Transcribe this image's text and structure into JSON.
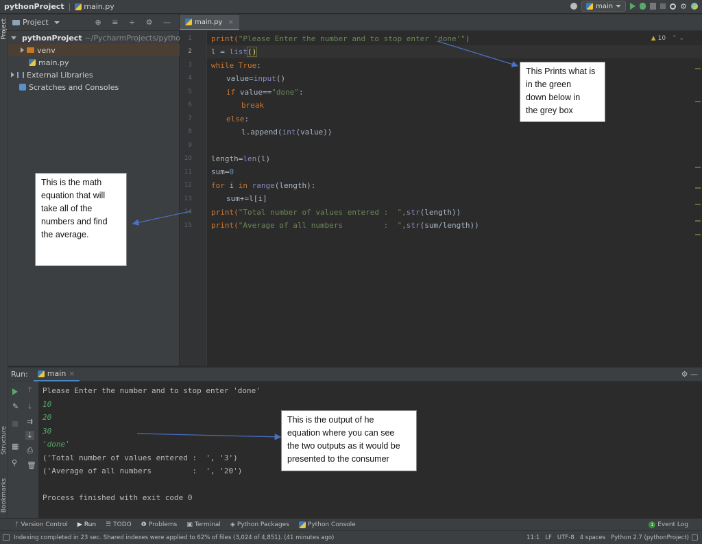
{
  "titlebar": {
    "project": "pythonProject",
    "file": "main.py",
    "run_config": "main"
  },
  "project_panel": {
    "header": "Project",
    "items": [
      {
        "label": "pythonProject",
        "path": "~/PycharmProjects/pythonProject"
      },
      {
        "label": "venv"
      },
      {
        "label": "main.py"
      },
      {
        "label": "External Libraries"
      },
      {
        "label": "Scratches and Consoles"
      }
    ]
  },
  "left_strip": {
    "project": "Project",
    "structure": "Structure",
    "bookmarks": "Bookmarks"
  },
  "editor": {
    "tab": "main.py",
    "warnings": "10",
    "line_numbers": [
      "1",
      "2",
      "3",
      "4",
      "5",
      "6",
      "7",
      "8",
      "9",
      "10",
      "11",
      "12",
      "13",
      "14",
      "15"
    ],
    "code": {
      "l1a": "print(",
      "l1b": "\"Please Enter the number and to stop enter 'done'\"",
      "l1c": ")",
      "l2a": "l",
      "l2b": " = ",
      "l2c": "list",
      "l2d": "()",
      "l3a": "while ",
      "l3b": "True",
      "l3c": ":",
      "l4a": "value",
      "l4b": "=",
      "l4c": "input",
      "l4d": "()",
      "l5a": "if ",
      "l5b": "value",
      "l5c": "==",
      "l5d": "\"done\"",
      "l5e": ":",
      "l6": "break",
      "l7a": "else",
      "l7b": ":",
      "l8a": "l.append(",
      "l8b": "int",
      "l8c": "(value))",
      "l10a": "length",
      "l10b": "=",
      "l10c": "len",
      "l10d": "(l)",
      "l11a": "sum",
      "l11b": "=",
      "l11c": "0",
      "l12a": "for ",
      "l12b": "i ",
      "l12c": "in ",
      "l12d": "range",
      "l12e": "(length):",
      "l13a": "sum",
      "l13b": "+=",
      "l13c": "l[i]",
      "l14a": "print(",
      "l14b": "\"Total number of values entered :  \"",
      "l14c": ",",
      "l14d": "str",
      "l14e": "(length))",
      "l15a": "print(",
      "l15b": "\"Average of all numbers         :  \"",
      "l15c": ",",
      "l15d": "str",
      "l15e": "(sum/length))"
    }
  },
  "run_panel": {
    "label": "Run:",
    "tab": "main",
    "output": {
      "prompt": "Please Enter the number and to stop enter 'done'",
      "in1": "10",
      "in2": "20",
      "in3": "30",
      "in4": "'done'",
      "res1": "('Total number of values entered :  ', '3')",
      "res2": "('Average of all numbers         :  ', '20')",
      "exit": "Process finished with exit code 0"
    }
  },
  "bottom_tools": {
    "version_control": "Version Control",
    "run": "Run",
    "todo": "TODO",
    "problems": "Problems",
    "terminal": "Terminal",
    "python_packages": "Python Packages",
    "python_console": "Python Console",
    "event_log": "Event Log",
    "event_count": "1"
  },
  "status_bar": {
    "message": "Indexing completed in 23 sec. Shared indexes were applied to 62% of files (3,024 of 4,851). (41 minutes ago)",
    "position": "11:1",
    "line_sep": "LF",
    "encoding": "UTF-8",
    "indent": "4 spaces",
    "interpreter": "Python 2.7 (pythonProject)"
  },
  "annotations": {
    "note1": [
      "This Prints what is",
      "in the green",
      "down below in",
      "the grey box"
    ],
    "note2": [
      "This is the math",
      "equation that will",
      "take all of the",
      "numbers and find",
      "the average."
    ],
    "note3": [
      "This is the output of he",
      "equation where you can see",
      "the two outputs as it would be",
      "presented to the consumer"
    ]
  },
  "colors": {
    "keyword": "#cc7832",
    "string": "#6a8759",
    "builtin": "#8888c6",
    "number": "#6897bb",
    "input_green": "#59a869",
    "arrow": "#4a72c4"
  }
}
